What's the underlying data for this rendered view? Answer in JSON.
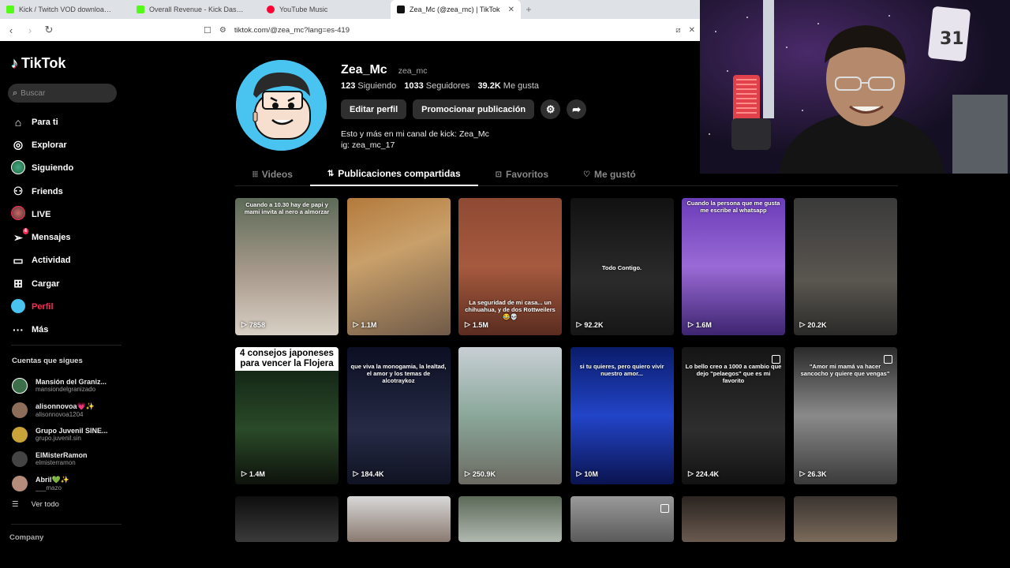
{
  "browser": {
    "tabs": [
      {
        "label": "Kick / Twitch VOD downloader",
        "fav_color": "#53fc18",
        "active": false
      },
      {
        "label": "Overall Revenue - Kick Dashboard",
        "fav_color": "#53fc18",
        "active": false
      },
      {
        "label": "YouTube Music",
        "fav_color": "#ff0033",
        "active": false
      },
      {
        "label": "Zea_Mc (@zea_mc) | TikTok",
        "fav_color": "#111111",
        "active": true
      }
    ],
    "url": "tiktok.com/@zea_mc?lang=es-419"
  },
  "sidebar": {
    "logo": "TikTok",
    "search_placeholder": "Buscar",
    "nav": [
      {
        "label": "Para ti",
        "icon": "home-icon"
      },
      {
        "label": "Explorar",
        "icon": "compass-icon"
      },
      {
        "label": "Siguiendo",
        "icon": "following-avatar-icon"
      },
      {
        "label": "Friends",
        "icon": "friends-icon"
      },
      {
        "label": "LIVE",
        "icon": "live-icon"
      },
      {
        "label": "Mensajes",
        "icon": "messages-icon",
        "badge": "4"
      },
      {
        "label": "Actividad",
        "icon": "activity-icon"
      },
      {
        "label": "Cargar",
        "icon": "upload-icon"
      },
      {
        "label": "Perfil",
        "icon": "profile-avatar-icon",
        "active": true
      },
      {
        "label": "Más",
        "icon": "more-icon"
      }
    ],
    "following_title": "Cuentas que sigues",
    "following": [
      {
        "name": "Mansión del Graniz...",
        "user": "mansiondelgranizado",
        "color": "#3a6f4a"
      },
      {
        "name": "alisonnovoa💗✨",
        "user": "alisonnovoa1204",
        "color": "#8c6d5a"
      },
      {
        "name": "Grupo Juvenil SINE...",
        "user": "grupo.juvenil.sin",
        "color": "#c9a33a"
      },
      {
        "name": "ElMisterRamon",
        "user": "elmisterramon",
        "color": "#444444"
      },
      {
        "name": "Abril💚✨",
        "user": "___mazo",
        "color": "#b58b7a"
      }
    ],
    "see_all": "Ver todo",
    "company": "Company"
  },
  "profile": {
    "display_name": "Zea_Mc",
    "username": "zea_mc",
    "following_count": "123",
    "following_label": "Siguiendo",
    "followers_count": "1033",
    "followers_label": "Seguidores",
    "likes_count": "39.2K",
    "likes_label": "Me gusta",
    "edit_label": "Editar perfil",
    "promote_label": "Promocionar publicación",
    "bio_line1": "Esto y más en mi canal de kick: Zea_Mc",
    "bio_line2": "ig: zea_mc_17"
  },
  "tabs": [
    {
      "label": "Videos",
      "icon": "grid-icon",
      "active": false
    },
    {
      "label": "Publicaciones compartidas",
      "icon": "repost-icon",
      "active": true
    },
    {
      "label": "Favoritos",
      "icon": "bookmark-icon",
      "active": false
    },
    {
      "label": "Me gustó",
      "icon": "heart-icon",
      "active": false
    }
  ],
  "videos": [
    {
      "views": "7858",
      "caption": "Cuando a 10.30 hay de papi y mami invita al nero a almorzar",
      "bg": "linear-gradient(180deg,#5d6b57 0%,#a89a8c 55%,#d8d0c4 100%)"
    },
    {
      "views": "1.1M",
      "caption": "",
      "bg": "linear-gradient(160deg,#b37a3c 0%,#c9a06a 40%,#6f5a48 100%)"
    },
    {
      "views": "1.5M",
      "caption": "La seguridad de mi casa... un chihuahua, y de dos Rottweilers 😂💀",
      "bg": "linear-gradient(180deg,#8f4a34 0%,#a65a3e 50%,#5a2c20 100%)"
    },
    {
      "views": "92.2K",
      "caption": "Todo Contigo.",
      "bg": "linear-gradient(180deg,#111 0%,#2b2b2b 60%,#161616 100%)"
    },
    {
      "views": "1.6M",
      "caption": "Cuando la persona que me gusta me escribe al whatsapp",
      "bg": "linear-gradient(180deg,#6a3cb8 0%,#9a6ad6 50%,#3d2570 100%)"
    },
    {
      "views": "20.2K",
      "caption": "",
      "bg": "linear-gradient(180deg,#3a3a3a 0%,#5a5650 60%,#2a2a28 100%)"
    },
    {
      "views": "1.4M",
      "caption": "",
      "title": "4 consejos japoneses para vencer la Flojera",
      "bg": "linear-gradient(180deg,#0c1a10 0%,#2a4a28 60%,#0e120c 100%)"
    },
    {
      "views": "184.4K",
      "caption": "que viva la monogamia, la lealtad, el amor y los temas de alcotraykoz",
      "bg": "linear-gradient(180deg,#0c0f22 0%,#262a45 60%,#101322 100%)"
    },
    {
      "views": "250.9K",
      "caption": "",
      "bg": "linear-gradient(180deg,#c8cfd4 0%,#8aa79a 50%,#6c6a62 100%)"
    },
    {
      "views": "10M",
      "caption": "si tu quieres, pero quiero vivir nuestro amor...",
      "bg": "linear-gradient(180deg,#0a1c6a 0%,#2244c8 50%,#0b1450 100%)"
    },
    {
      "views": "224.4K",
      "caption": "Lo bello creo a 1000 a cambio que dejo \"pelaegos\" que es mi favorito",
      "bg": "linear-gradient(180deg,#151515 0%,#2e2e2e 60%,#121212 100%)",
      "multi": true
    },
    {
      "views": "26.3K",
      "caption": "\"Amor mi mamá va hacer sancocho y quiere que vengas\"",
      "bg": "linear-gradient(180deg,#2a2a2a 0%,#8a8a8a 50%,#3a3a3a 100%)",
      "multi": true
    },
    {
      "views": "",
      "caption": "",
      "bg": "linear-gradient(180deg,#0e0e0e 0%,#3a3a3a 100%)"
    },
    {
      "views": "",
      "caption": "",
      "bg": "linear-gradient(180deg,#d8d8d8 0%,#8a7a70 100%)"
    },
    {
      "views": "",
      "caption": "",
      "bg": "linear-gradient(180deg,#5c6a58 0%,#b0b8b0 100%)"
    },
    {
      "views": "",
      "caption": "",
      "bg": "linear-gradient(180deg,#9a9a9a 0%,#5a5a5a 100%)",
      "multi": true
    },
    {
      "views": "",
      "caption": "",
      "bg": "linear-gradient(180deg,#2a2420 0%,#6a5a50 100%)"
    },
    {
      "views": "",
      "caption": "",
      "bg": "linear-gradient(180deg,#3a3430 0%,#7a6a5a 100%)"
    }
  ]
}
